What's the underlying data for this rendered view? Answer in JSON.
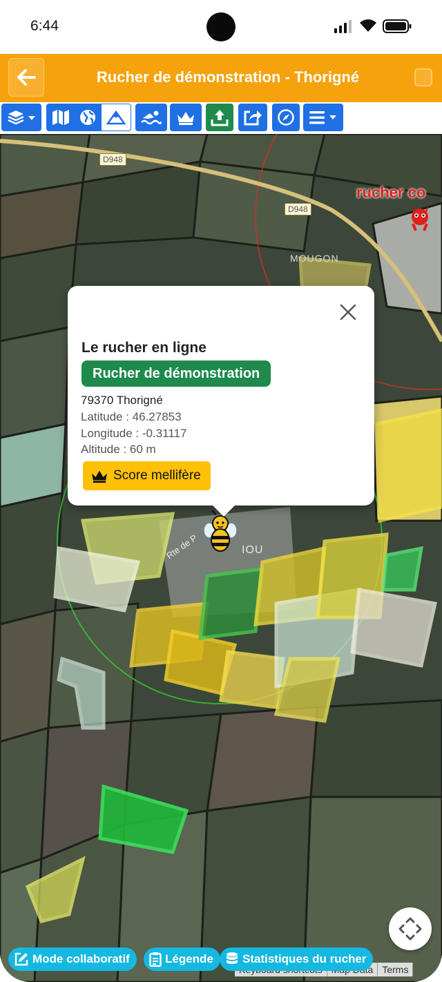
{
  "status_bar": {
    "time": "6:44"
  },
  "header": {
    "title": "Rucher de démonstration - Thorigné"
  },
  "toolbar": {
    "buttons": [
      {
        "name": "layers",
        "icon": "layers-icon"
      },
      {
        "name": "map-view",
        "icon": "map-icon"
      },
      {
        "name": "satellite-view",
        "icon": "globe-icon"
      },
      {
        "name": "terrain-view",
        "icon": "mountain-icon"
      },
      {
        "name": "draw",
        "icon": "swimmer-icon"
      },
      {
        "name": "score",
        "icon": "crown-icon"
      },
      {
        "name": "upload",
        "icon": "upload-icon"
      },
      {
        "name": "share",
        "icon": "share-icon"
      },
      {
        "name": "locate",
        "icon": "compass-icon"
      },
      {
        "name": "menu",
        "icon": "menu-icon"
      }
    ]
  },
  "map": {
    "road_labels": [
      "D948",
      "D948"
    ],
    "place_labels": [
      "MOUGON",
      "IOU"
    ],
    "street_label": "Rte de P",
    "other_apiary_label": "rucher co"
  },
  "popup": {
    "heading": "Le rucher en ligne",
    "apiary_name": "Rucher de démonstration",
    "address": "79370 Thorigné",
    "latitude": "Latitude : 46.27853",
    "longitude": "Longitude : -0.31117",
    "altitude": "Altitude : 60 m",
    "score_button": "Score mellifère"
  },
  "attribution": {
    "keyboard": "Keyboard shortcuts",
    "map_data": "Map Data",
    "terms": "Terms"
  },
  "bottom_buttons": {
    "collab": "Mode collaboratif",
    "legend": "Légende",
    "stats": "Statistiques du rucher"
  },
  "colors": {
    "header": "#f6a20c",
    "toolbar_blue": "#1f6fe5",
    "toolbar_green": "#1e8a4c",
    "pill_green": "#1e8a4c",
    "score_yellow": "#ffc107",
    "bottom_cyan": "#14b8e0"
  }
}
